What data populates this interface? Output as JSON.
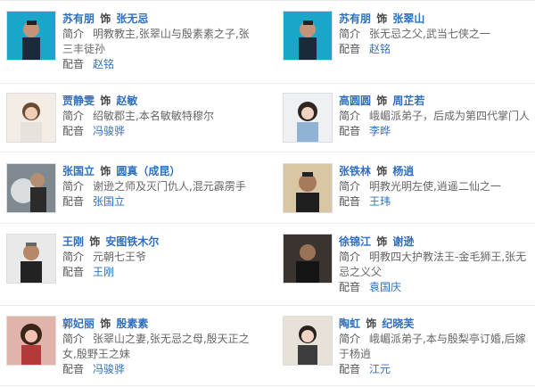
{
  "cast": [
    {
      "actor": "苏有朋",
      "rel": "饰",
      "role": "张无忌",
      "desc": "明教教主,张翠山与殷素素之子,张三丰徒孙",
      "va": "赵铭",
      "intro_label": "简介",
      "va_label": "配音",
      "photo_icon": "actor-portrait"
    },
    {
      "actor": "苏有朋",
      "rel": "饰",
      "role": "张翠山",
      "desc": "张无忌之父,武当七侠之一",
      "va": "赵铭",
      "intro_label": "简介",
      "va_label": "配音",
      "photo_icon": "actor-portrait"
    },
    {
      "actor": "贾静雯",
      "rel": "饰",
      "role": "赵敏",
      "desc": "绍敏郡主,本名敏敏特穆尔",
      "va": "冯骏骅",
      "intro_label": "简介",
      "va_label": "配音",
      "photo_icon": "actress-portrait"
    },
    {
      "actor": "高圆圆",
      "rel": "饰",
      "role": "周芷若",
      "desc": "峨嵋派弟子，后成为第四代掌门人",
      "va": "李晔",
      "intro_label": "简介",
      "va_label": "配音",
      "photo_icon": "actress-portrait"
    },
    {
      "actor": "张国立",
      "rel": "饰",
      "role": "圆真（成昆）",
      "desc": "谢逊之师及灭门仇人,混元霹雳手",
      "va": "张国立",
      "intro_label": "简介",
      "va_label": "配音",
      "photo_icon": "actor-portrait"
    },
    {
      "actor": "张铁林",
      "rel": "饰",
      "role": "杨逍",
      "desc": "明教光明左使,逍遥二仙之一",
      "va": "王玮",
      "intro_label": "简介",
      "va_label": "配音",
      "photo_icon": "actor-portrait"
    },
    {
      "actor": "王刚",
      "rel": "饰",
      "role": "安图铁木尔",
      "desc": "元朝七王爷",
      "va": "王刚",
      "intro_label": "简介",
      "va_label": "配音",
      "photo_icon": "actor-portrait"
    },
    {
      "actor": "徐锦江",
      "rel": "饰",
      "role": "谢逊",
      "desc": "明教四大护教法王-金毛狮王,张无忌之义父",
      "va": "袁国庆",
      "intro_label": "简介",
      "va_label": "配音",
      "photo_icon": "actor-portrait"
    },
    {
      "actor": "郭妃丽",
      "rel": "饰",
      "role": "殷素素",
      "desc": "张翠山之妻,张无忌之母,殷天正之女,殷野王之妹",
      "va": "冯骏骅",
      "intro_label": "简介",
      "va_label": "配音",
      "photo_icon": "actress-portrait"
    },
    {
      "actor": "陶虹",
      "rel": "饰",
      "role": "纪晓芙",
      "desc": "峨嵋派弟子,本与殷梨亭订婚,后嫁于杨逍",
      "va": "江元",
      "intro_label": "简介",
      "va_label": "配音",
      "photo_icon": "actress-portrait"
    }
  ]
}
